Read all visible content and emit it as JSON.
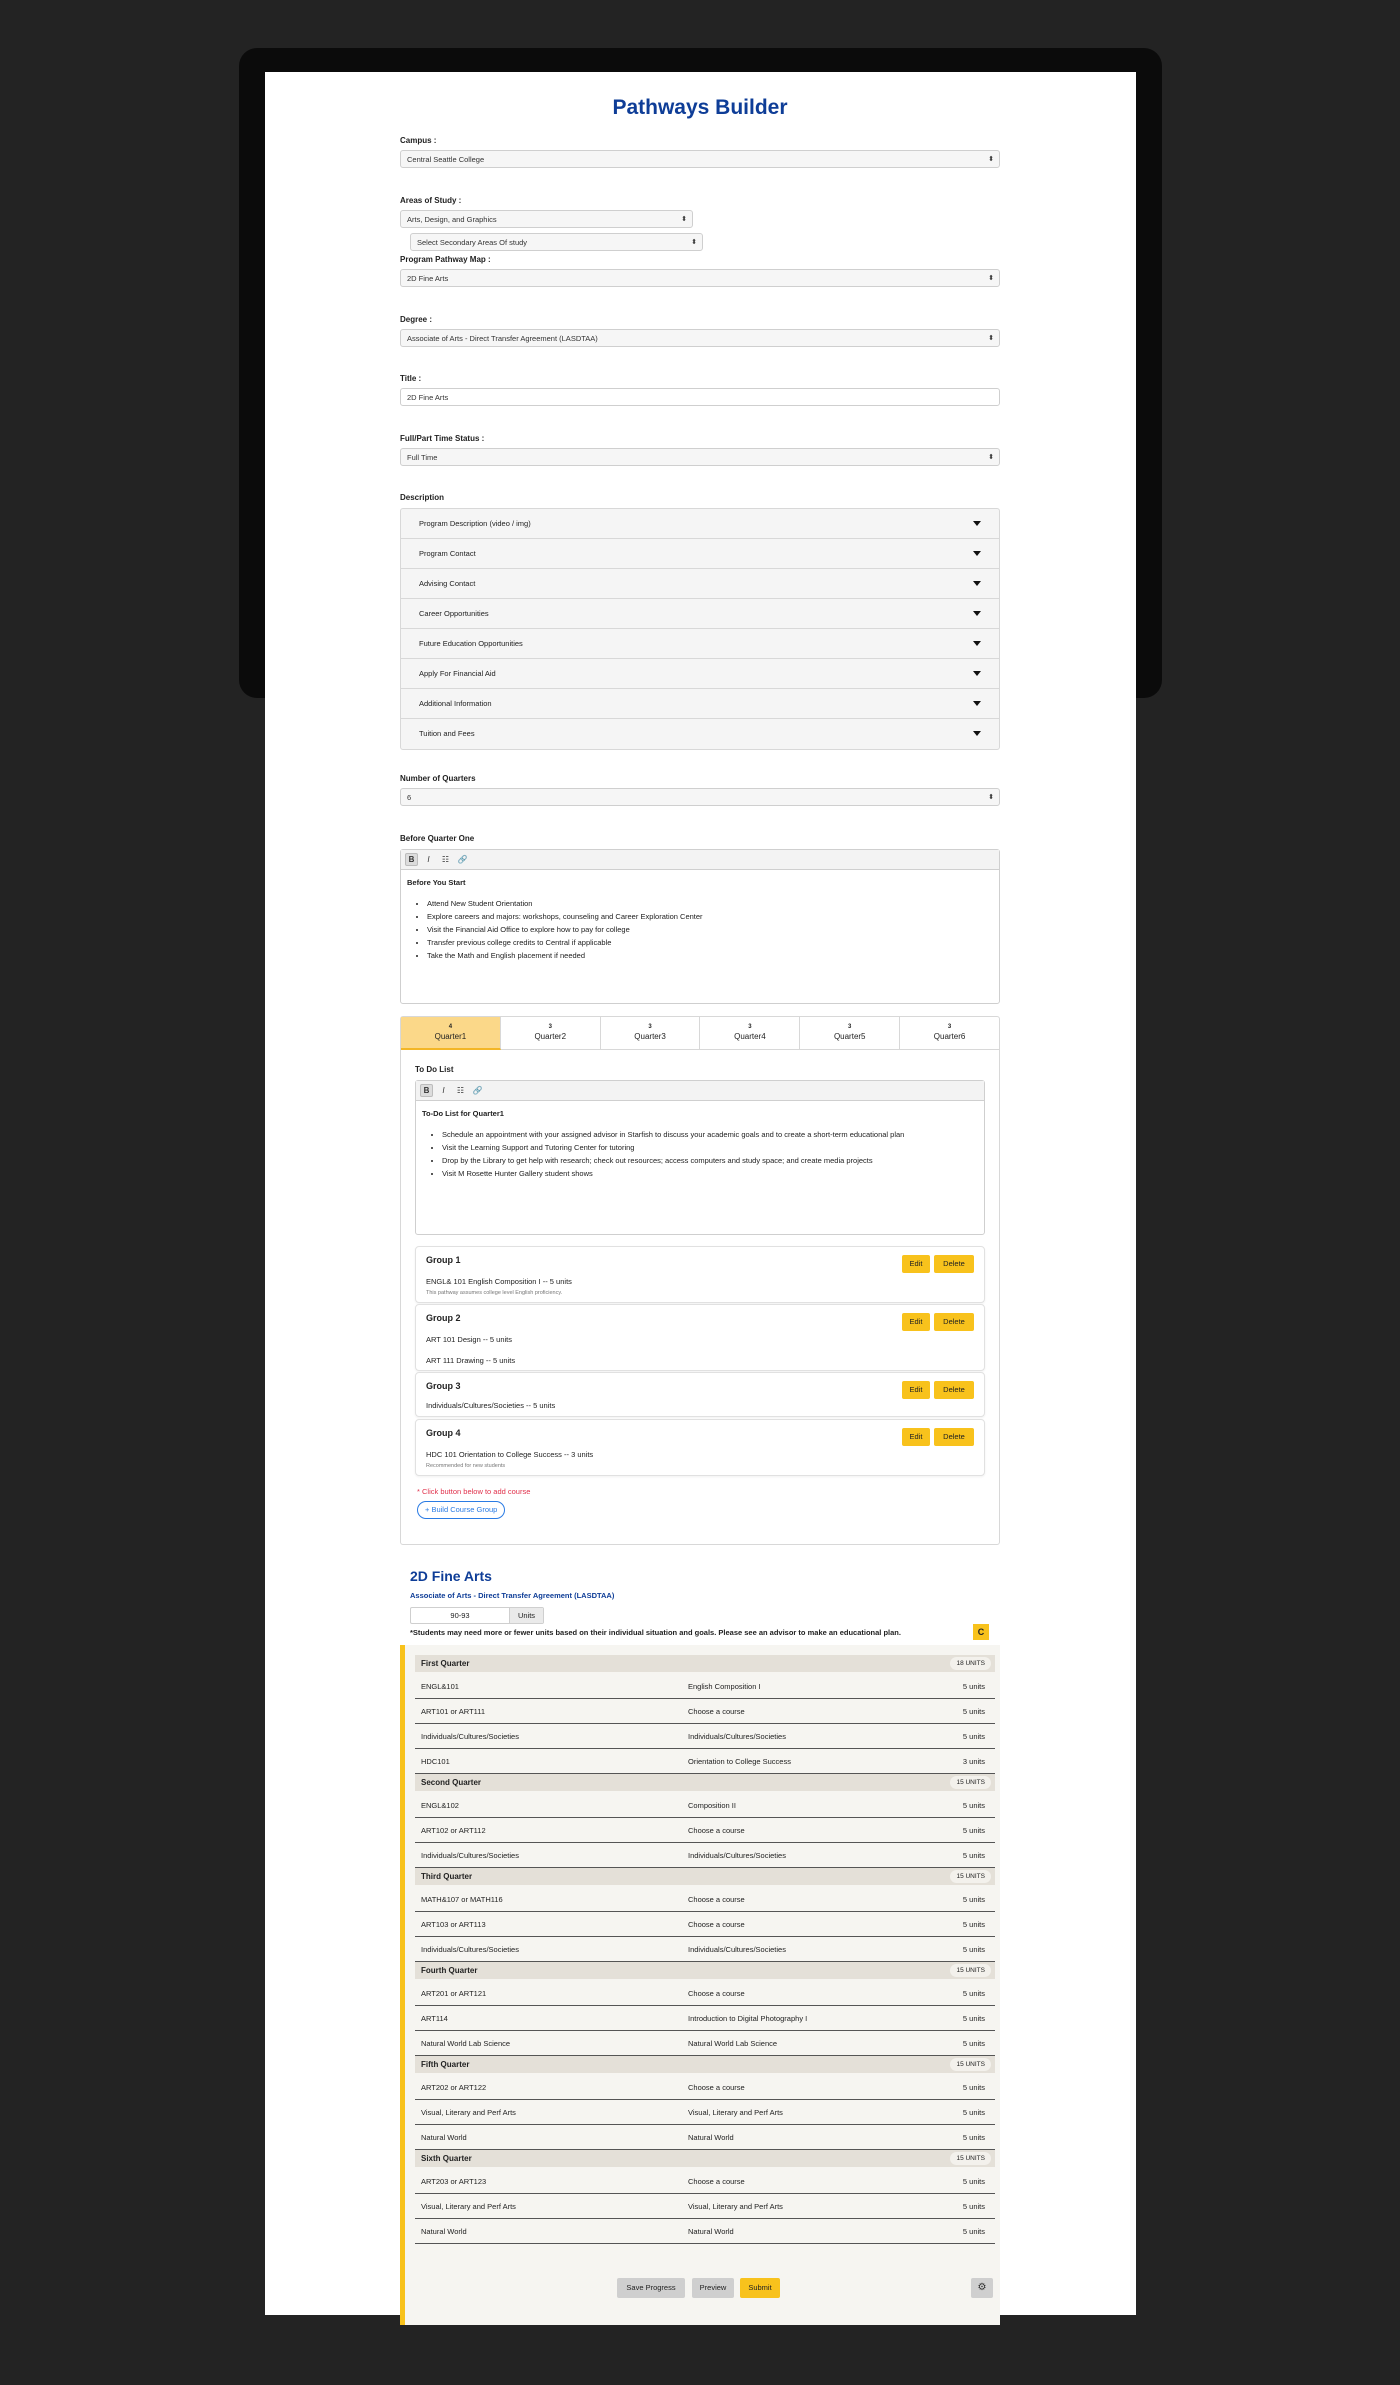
{
  "header": {
    "title": "Pathways Builder"
  },
  "campus": {
    "label": "Campus :",
    "value": "Central Seattle College"
  },
  "areas": {
    "label": "Areas of Study :",
    "primary": "Arts, Design, and Graphics",
    "secondary": "Select Secondary Areas Of study"
  },
  "pathway": {
    "label": "Program Pathway Map :",
    "value": "2D Fine Arts"
  },
  "degree": {
    "label": "Degree :",
    "value": "Associate of Arts - Direct Transfer Agreement (LASDTAA)"
  },
  "title_field": {
    "label": "Title :",
    "value": "2D Fine Arts"
  },
  "status": {
    "label": "Full/Part Time Status :",
    "value": "Full Time"
  },
  "description": {
    "label": "Description",
    "items": [
      "Program Description (video / img)",
      "Program Contact",
      "Advising Contact",
      "Career Opportunities",
      "Future Education Opportunities",
      "Apply For Financial Aid",
      "Additional Information",
      "Tuition and Fees"
    ]
  },
  "quarters_count": {
    "label": "Number of Quarters",
    "value": "6"
  },
  "before": {
    "label": "Before Quarter One",
    "toolbar": {
      "bold": "B",
      "italic": "I",
      "list": "☷",
      "link": "🔗"
    },
    "heading": "Before You Start",
    "items": [
      "Attend New Student Orientation",
      "Explore careers and majors: workshops, counseling and Career Exploration Center",
      "Visit the Financial Aid Office to explore how to pay for college",
      "Transfer previous college credits to Central if applicable",
      "Take the Math and English placement if needed"
    ]
  },
  "tabs": [
    {
      "num": "4",
      "label": "Quarter1"
    },
    {
      "num": "3",
      "label": "Quarter2"
    },
    {
      "num": "3",
      "label": "Quarter3"
    },
    {
      "num": "3",
      "label": "Quarter4"
    },
    {
      "num": "3",
      "label": "Quarter5"
    },
    {
      "num": "3",
      "label": "Quarter6"
    }
  ],
  "todo": {
    "label": "To Do List",
    "heading": "To-Do List for Quarter1",
    "items": [
      "Schedule an appointment with your assigned advisor in Starfish to discuss your academic goals and to create a short-term educational plan",
      "Visit the Learning Support and Tutoring Center for tutoring",
      "Drop by the Library to get help with research; check out resources; access computers and study space; and create media projects",
      "Visit M Rosette Hunter Gallery student shows"
    ]
  },
  "groups": [
    {
      "name": "Group 1",
      "course1": "ENGL& 101 English Composition I -- 5 units",
      "note": "This pathway assumes college level English proficiency.",
      "edit": "Edit",
      "delete": "Delete"
    },
    {
      "name": "Group 2",
      "course1": "ART 101 Design -- 5 units",
      "course2": "ART 111 Drawing -- 5 units",
      "edit": "Edit",
      "delete": "Delete"
    },
    {
      "name": "Group 3",
      "course1": "Individuals/Cultures/Societies -- 5 units",
      "edit": "Edit",
      "delete": "Delete"
    },
    {
      "name": "Group 4",
      "course1": "HDC 101 Orientation to College Success -- 3 units",
      "note": "Recommended for new students",
      "edit": "Edit",
      "delete": "Delete"
    }
  ],
  "hint": "* Click button below to add course",
  "build_button": "+ Build Course Group",
  "preview": {
    "title": "2D Fine Arts",
    "degree": "Associate of Arts - Direct Transfer Agreement (LASDTAA)",
    "units_value": "90-93",
    "units_label": "Units",
    "note": "*Students may need more or fewer units based on their individual situation and goals. Please see an advisor to make an educational plan.",
    "badge": "C"
  },
  "plan": [
    {
      "quarter": "First Quarter",
      "units": "18 UNITS",
      "rows": [
        [
          "ENGL&101",
          "English Composition I",
          "5 units"
        ],
        [
          "ART101 or ART111",
          "Choose a course",
          "5 units"
        ],
        [
          "Individuals/Cultures/Societies",
          "Individuals/Cultures/Societies",
          "5 units"
        ],
        [
          "HDC101",
          "Orientation to College Success",
          "3 units"
        ]
      ]
    },
    {
      "quarter": "Second Quarter",
      "units": "15 UNITS",
      "rows": [
        [
          "ENGL&102",
          "Composition II",
          "5 units"
        ],
        [
          "ART102 or ART112",
          "Choose a course",
          "5 units"
        ],
        [
          "Individuals/Cultures/Societies",
          "Individuals/Cultures/Societies",
          "5 units"
        ]
      ]
    },
    {
      "quarter": "Third Quarter",
      "units": "15 UNITS",
      "rows": [
        [
          "MATH&107 or MATH116",
          "Choose a course",
          "5 units"
        ],
        [
          "ART103 or ART113",
          "Choose a course",
          "5 units"
        ],
        [
          "Individuals/Cultures/Societies",
          "Individuals/Cultures/Societies",
          "5 units"
        ]
      ]
    },
    {
      "quarter": "Fourth Quarter",
      "units": "15 UNITS",
      "rows": [
        [
          "ART201 or ART121",
          "Choose a course",
          "5 units"
        ],
        [
          "ART114",
          "Introduction to Digital Photography I",
          "5 units"
        ],
        [
          "Natural World Lab Science",
          "Natural World Lab Science",
          "5 units"
        ]
      ]
    },
    {
      "quarter": "Fifth Quarter",
      "units": "15 UNITS",
      "rows": [
        [
          "ART202 or ART122",
          "Choose a course",
          "5 units"
        ],
        [
          "Visual, Literary and Perf Arts",
          "Visual, Literary and Perf Arts",
          "5 units"
        ],
        [
          "Natural World",
          "Natural World",
          "5 units"
        ]
      ]
    },
    {
      "quarter": "Sixth Quarter",
      "units": "15 UNITS",
      "rows": [
        [
          "ART203 or ART123",
          "Choose a course",
          "5 units"
        ],
        [
          "Visual, Literary and Perf Arts",
          "Visual, Literary and Perf Arts",
          "5 units"
        ],
        [
          "Natural World",
          "Natural World",
          "5 units"
        ]
      ]
    }
  ],
  "actions": {
    "save": "Save Progress",
    "preview": "Preview",
    "submit": "Submit",
    "gear_icon": "gear-icon"
  },
  "colors": {
    "brand_blue": "#0e3d97",
    "accent_yellow": "#f8c21c",
    "tab_active": "#fbd889",
    "hint_red": "#e0314b"
  }
}
